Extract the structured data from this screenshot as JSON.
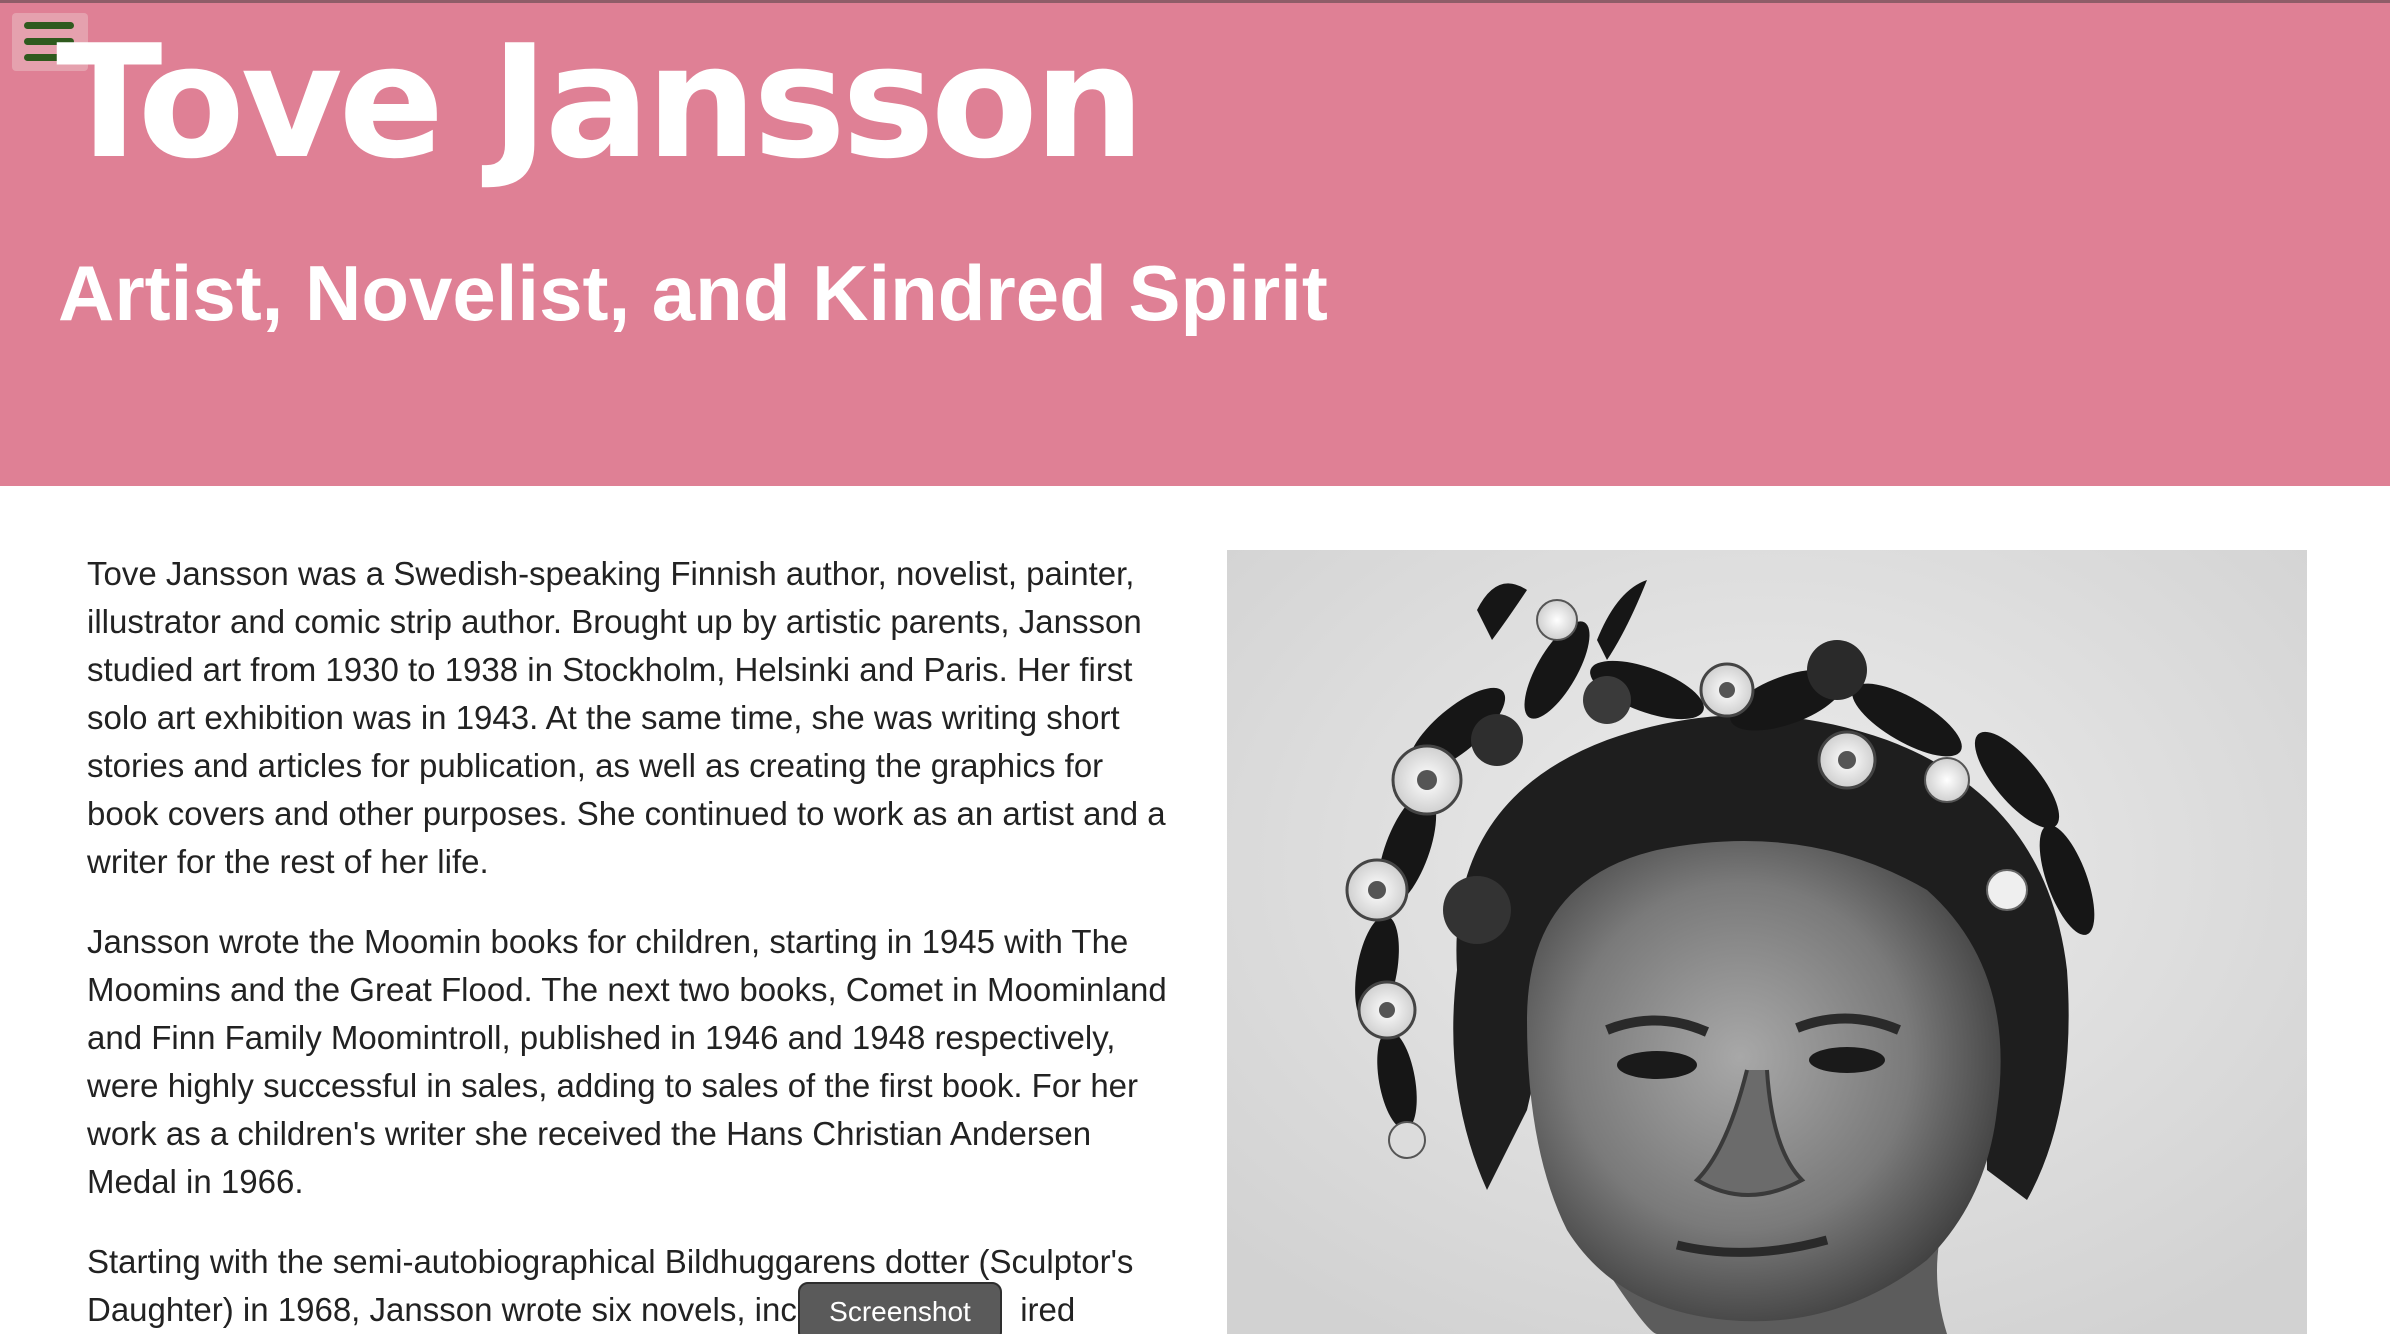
{
  "header": {
    "title": "Tove Jansson",
    "subtitle": "Artist, Novelist, and Kindred Spirit",
    "menu_icon": "hamburger-menu-icon"
  },
  "main": {
    "paragraphs": [
      "Tove Jansson was a Swedish-speaking Finnish author, novelist, painter, illustrator and comic strip author. Brought up by artistic parents, Jansson studied art from 1930 to 1938 in Stockholm, Helsinki and Paris. Her first solo art exhibition was in 1943. At the same time, she was writing short stories and articles for publication, as well as creating the graphics for book covers and other purposes. She continued to work as an artist and a writer for the rest of her life.",
      "Jansson wrote the Moomin books for children, starting in 1945 with The Moomins and the Great Flood. The next two books, Comet in Moominland and Finn Family Moomintroll, published in 1946 and 1948 respectively, were highly successful in sales, adding to sales of the first book. For her work as a children's writer she received the Hans Christian Andersen Medal in 1966.",
      "Starting with the semi-autobiographical Bildhuggarens dotter (Sculptor's Daughter) in 1968, Jansson wrote six novels, incl"
    ],
    "paragraph3_tail": "ired"
  },
  "overlay": {
    "tooltip": "Screenshot"
  },
  "colors": {
    "header_bg": "#df8095",
    "menu_bar": "#2f5a1e",
    "text": "#222222"
  }
}
